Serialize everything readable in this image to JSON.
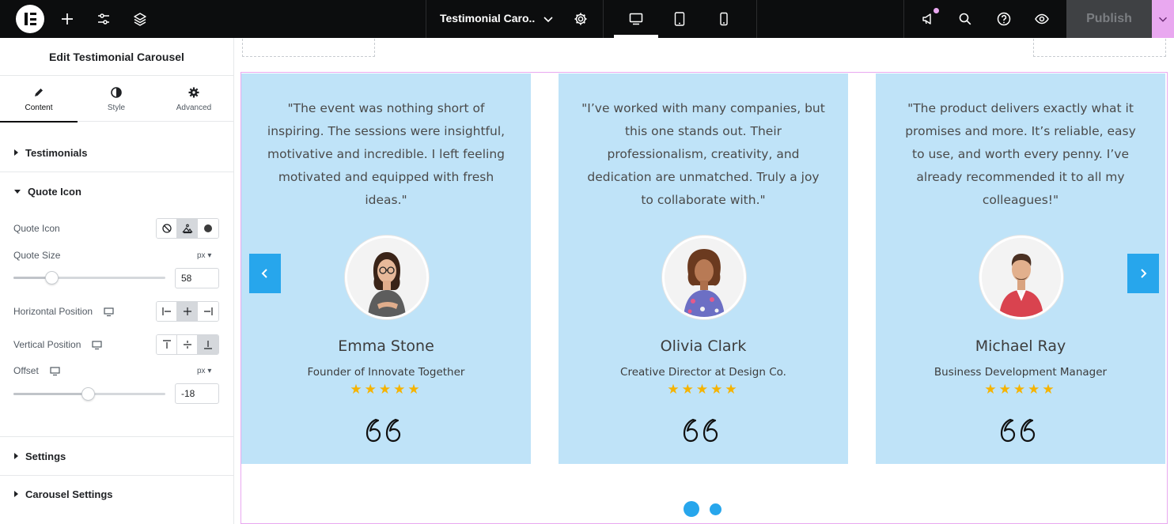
{
  "topbar": {
    "document_title": "Testimonial Caro...",
    "publish_label": "Publish"
  },
  "panel": {
    "title": "Edit Testimonial Carousel",
    "tabs": [
      {
        "label": "Content",
        "icon": "pencil-icon",
        "active": true
      },
      {
        "label": "Style",
        "icon": "contrast-icon",
        "active": false
      },
      {
        "label": "Advanced",
        "icon": "gear-icon",
        "active": false
      }
    ],
    "sections": {
      "testimonials": "Testimonials",
      "quote_icon": "Quote Icon",
      "settings": "Settings",
      "carousel_settings": "Carousel Settings"
    },
    "controls": {
      "quote_icon_label": "Quote Icon",
      "quote_size_label": "Quote Size",
      "quote_size_unit": "px",
      "quote_size_value": "58",
      "quote_size_level": 0.25,
      "horizontal_position_label": "Horizontal Position",
      "vertical_position_label": "Vertical Position",
      "offset_label": "Offset",
      "offset_unit": "px",
      "offset_value": "-18",
      "offset_level": 0.49
    }
  },
  "testimonials": [
    {
      "quote": "\"The event was nothing short of inspiring. The sessions were insightful, motivative and incredible. I left feeling motivated and equipped with fresh ideas.\"",
      "name": "Emma Stone",
      "role": "Founder of Innovate Together",
      "stars": "★★★★★",
      "rating": 5
    },
    {
      "quote": "\"I’ve worked with many companies, but this one stands out. Their professionalism, creativity, and dedication are unmatched. Truly a joy to collaborate with.\"",
      "name": "Olivia Clark",
      "role": "Creative Director at Design Co.",
      "stars": "★★★★★",
      "rating": 5
    },
    {
      "quote": "\"The product delivers exactly what it promises and more. It’s reliable, easy to use, and worth every penny. I’ve already recommended it to all my colleagues!\"",
      "name": "Michael Ray",
      "role": "Business Development Manager",
      "stars": "★★★★★",
      "rating": 5
    }
  ],
  "colors": {
    "card_bg": "#bfe3f8",
    "accent": "#27a6ec",
    "star": "#f5b301",
    "selection_outline": "#e9a8f0",
    "topbar_bg": "#0c0d0e"
  }
}
